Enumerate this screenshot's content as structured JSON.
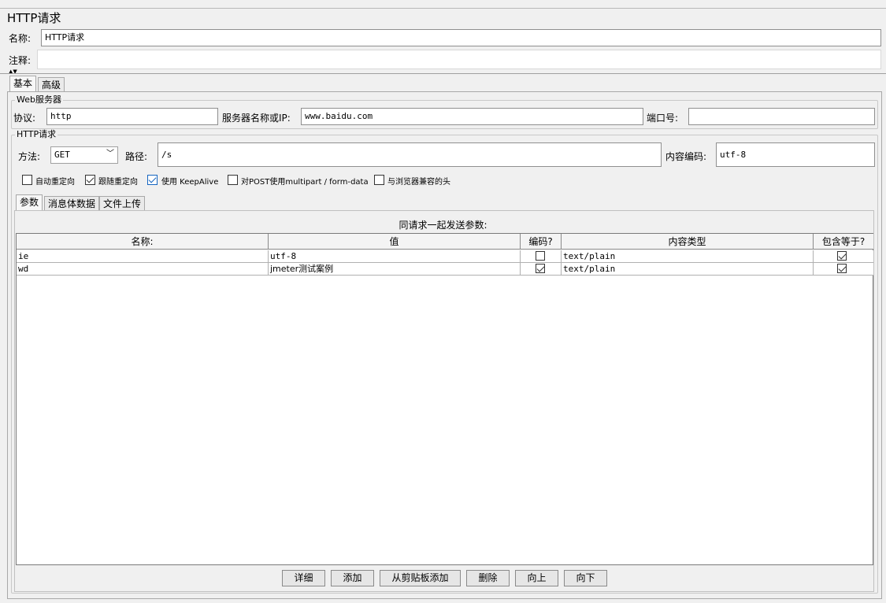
{
  "header": {
    "title": "HTTP请求",
    "name_label": "名称:",
    "name_value": "HTTP请求",
    "comment_label": "注释:",
    "comment_value": ""
  },
  "tabs": [
    "基本",
    "高级"
  ],
  "web_server": {
    "group_title": "Web服务器",
    "protocol_label": "协议:",
    "protocol_value": "http",
    "server_label": "服务器名称或IP:",
    "server_value": "www.baidu.com",
    "port_label": "端口号:",
    "port_value": ""
  },
  "http_request": {
    "group_title": "HTTP请求",
    "method_label": "方法:",
    "method_value": "GET",
    "path_label": "路径:",
    "path_value": "/s",
    "encoding_label": "内容编码:",
    "encoding_value": "utf-8"
  },
  "options": [
    {
      "label": "自动重定向",
      "checked": false
    },
    {
      "label": "跟随重定向",
      "checked": true
    },
    {
      "label": "使用 KeepAlive",
      "checked": true
    },
    {
      "label": "对POST使用multipart / form-data",
      "checked": false
    },
    {
      "label": "与浏览器兼容的头",
      "checked": false
    }
  ],
  "subtabs": [
    "参数",
    "消息体数据",
    "文件上传"
  ],
  "params": {
    "caption": "同请求一起发送参数:",
    "columns": [
      "名称:",
      "值",
      "编码?",
      "内容类型",
      "包含等于?"
    ],
    "rows": [
      {
        "name": "ie",
        "value": "utf-8",
        "encode": false,
        "content_type": "text/plain",
        "include_equals": true
      },
      {
        "name": "wd",
        "value": "jmeter测试案例",
        "encode": true,
        "content_type": "text/plain",
        "include_equals": true
      }
    ]
  },
  "buttons": [
    "详细",
    "添加",
    "从剪贴板添加",
    "删除",
    "向上",
    "向下"
  ],
  "colors": {
    "background": "#f0f0f0",
    "checkbox_accent": "#1565c0",
    "border": "#8f8f8f"
  }
}
